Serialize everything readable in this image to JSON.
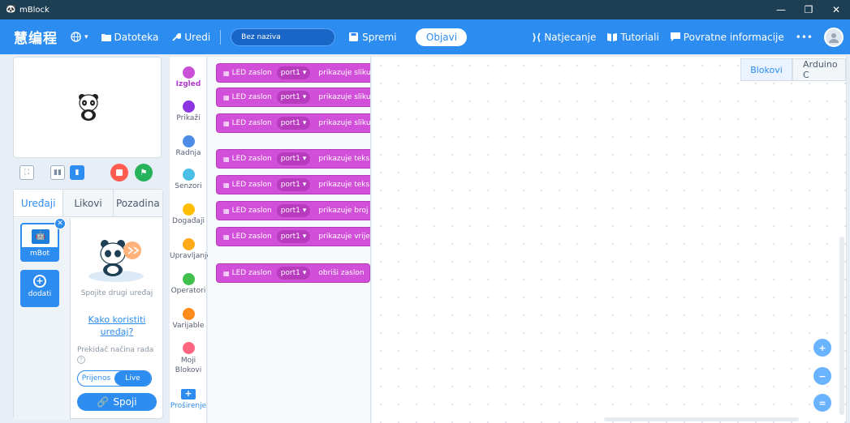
{
  "window": {
    "title": "mBlock",
    "controls": [
      "—",
      "❐",
      "✕"
    ]
  },
  "menubar": {
    "logo": "慧编程",
    "globe_icon": "globe-icon",
    "file_label": "Datoteka",
    "edit_label": "Uredi",
    "project_name": "Bez naziva",
    "save_label": "Spremi",
    "publish_label": "Objavi",
    "competition_label": "Natjecanje",
    "tutorials_label": "Tutoriali",
    "feedback_label": "Povratne informacije",
    "more_label": "•••"
  },
  "device_panel": {
    "tabs": [
      "Uređaji",
      "Likovi",
      "Pozadina"
    ],
    "active_tab": "Uređaji",
    "device_name": "mBot",
    "add_label": "dodati",
    "connect_other": "Spojite drugi uređaj",
    "how_to": "Kako koristiti uređaj?",
    "mode_label": "Prekidač načina rada",
    "mode_options": [
      "Prijenos",
      "Live"
    ],
    "mode_selected": "Live",
    "connect_button": "Spoji"
  },
  "categories": [
    {
      "label": "Izgled",
      "color": "#c84fd6"
    },
    {
      "label": "Prikaži",
      "color": "#8d35e0"
    },
    {
      "label": "Radnja",
      "color": "#4d8ce6"
    },
    {
      "label": "Senzori",
      "color": "#4cbfe6"
    },
    {
      "label": "Događaji",
      "color": "#ffbf00"
    },
    {
      "label": "Upravljanje",
      "color": "#ffab19"
    },
    {
      "label": "Operatori",
      "color": "#40bf4a"
    },
    {
      "label": "Varijable",
      "color": "#ff8c1a"
    },
    {
      "label": "Moji Blokovi",
      "color": "#ff6680"
    }
  ],
  "active_category": "Izgled",
  "extensions_label": "Proširenje",
  "blocks": [
    {
      "prefix": "LED zaslon",
      "port": "port1",
      "rest": "prikazuje sliku"
    },
    {
      "prefix": "LED zaslon",
      "port": "port1",
      "rest": "prikazuje sliku"
    },
    {
      "prefix": "LED zaslon",
      "port": "port1",
      "rest": "prikazuje sliku"
    },
    {
      "prefix": "LED zaslon",
      "port": "port1",
      "rest": "prikazuje teks"
    },
    {
      "prefix": "LED zaslon",
      "port": "port1",
      "rest": "prikazuje teks"
    },
    {
      "prefix": "LED zaslon",
      "port": "port1",
      "rest": "prikazuje broj"
    },
    {
      "prefix": "LED zaslon",
      "port": "port1",
      "rest": "prikazuje vrije"
    },
    {
      "prefix": "LED zaslon",
      "port": "port1",
      "rest": "obriši zaslon"
    }
  ],
  "workspace": {
    "tabs": [
      "Blokovi",
      "Arduino C"
    ],
    "active_tab": "Blokovi",
    "zoom_in": "+",
    "zoom_out": "−",
    "zoom_reset": "="
  }
}
